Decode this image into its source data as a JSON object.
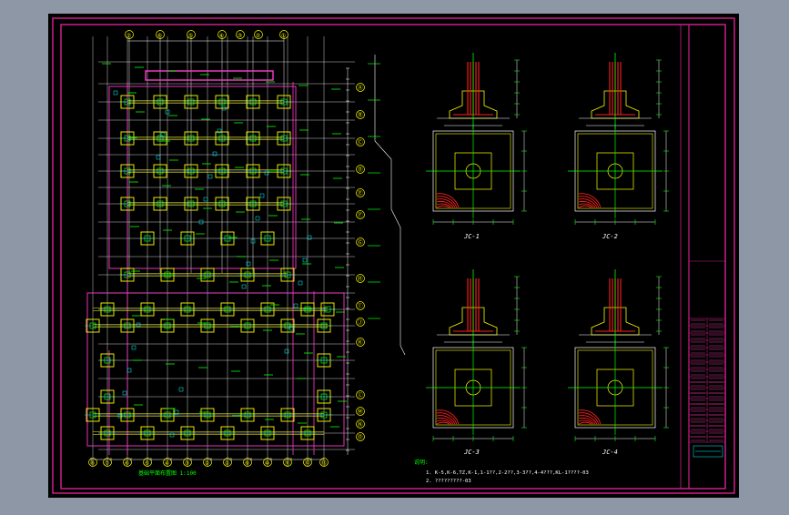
{
  "grid_top_labels": [
    "⑦",
    "⑥",
    "⑤",
    "④",
    "③",
    "②",
    "①"
  ],
  "grid_bottom_labels": [
    "⑧",
    "⑦",
    "⑥",
    "⑤",
    "④",
    "③",
    "②",
    "①",
    "⑨",
    "⑩",
    "⑪",
    "⑫",
    "⑬"
  ],
  "grid_right_labels": [
    "Ⓐ",
    "Ⓑ",
    "Ⓒ",
    "Ⓓ",
    "Ⓔ",
    "Ⓕ",
    "Ⓖ",
    "Ⓗ",
    "Ⓘ",
    "Ⓙ",
    "Ⓚ",
    "Ⓛ",
    "Ⓜ",
    "Ⓝ",
    "Ⓞ"
  ],
  "detail_titles": [
    "JC-1",
    "JC-2",
    "JC-3",
    "JC-4"
  ],
  "notes": {
    "heading": "说明:",
    "line1": "1. K-5,K-6,TZ,K-1,1-1??,2-2??,3-3??,4-4???,KL-1????-03",
    "line2": "2. ?????????-03"
  },
  "plan_caption": "基础平面布置图 1:100",
  "colors": {
    "background": "#000000",
    "frame": "#cc1f8a",
    "grid": "#ffffff",
    "yellow": "#ffff00",
    "green": "#00ff00",
    "cyan": "#00ffff",
    "red": "#ff2020"
  }
}
